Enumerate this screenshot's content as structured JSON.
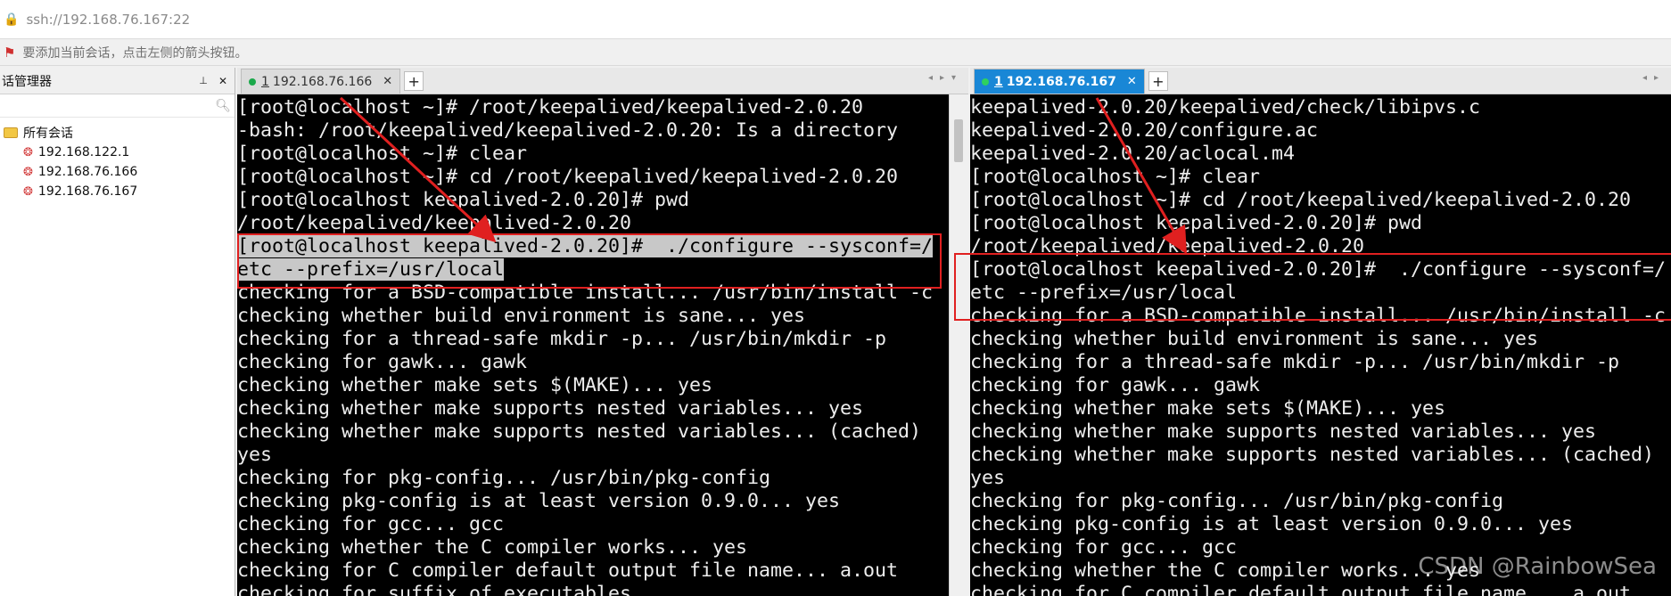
{
  "address_bar": {
    "url": "ssh://192.168.76.167:22"
  },
  "hint_bar": {
    "text": "要添加当前会话，点击左侧的箭头按钮。"
  },
  "session_manager": {
    "title": "话管理器",
    "pin": "📌",
    "close": "✕",
    "tree": {
      "root": "所有会话",
      "children": [
        "192.168.122.1",
        "192.168.76.166",
        "192.168.76.167"
      ]
    }
  },
  "left_pane": {
    "tab": {
      "num": "1",
      "label": "192.168.76.166",
      "close": "✕"
    },
    "lines": [
      "[root@localhost ~]# /root/keepalived/keepalived-2.0.20",
      "-bash: /root/keepalived/keepalived-2.0.20: Is a directory",
      "[root@localhost ~]# clear",
      "[root@localhost ~]# cd /root/keepalived/keepalived-2.0.20",
      "[root@localhost keepalived-2.0.20]# pwd",
      "/root/keepalived/keepalived-2.0.20",
      "[root@localhost keepalived-2.0.20]#  ./configure --sysconf=/",
      "etc --prefix=/usr/local",
      "checking for a BSD-compatible install... /usr/bin/install -c",
      "checking whether build environment is sane... yes",
      "checking for a thread-safe mkdir -p... /usr/bin/mkdir -p",
      "checking for gawk... gawk",
      "checking whether make sets $(MAKE)... yes",
      "checking whether make supports nested variables... yes",
      "checking whether make supports nested variables... (cached)",
      "yes",
      "checking for pkg-config... /usr/bin/pkg-config",
      "checking pkg-config is at least version 0.9.0... yes",
      "checking for gcc... gcc",
      "checking whether the C compiler works... yes",
      "checking for C compiler default output file name... a.out",
      "checking for suffix of executables..."
    ]
  },
  "right_pane": {
    "tab": {
      "num": "1",
      "label": "192.168.76.167",
      "close": "✕"
    },
    "lines": [
      "keepalived-2.0.20/keepalived/check/libipvs.c",
      "keepalived-2.0.20/configure.ac",
      "keepalived-2.0.20/aclocal.m4",
      "[root@localhost ~]# clear",
      "[root@localhost ~]# cd /root/keepalived/keepalived-2.0.20",
      "[root@localhost keepalived-2.0.20]# pwd",
      "/root/keepalived/keepalived-2.0.20",
      "[root@localhost keepalived-2.0.20]#  ./configure --sysconf=/",
      "etc --prefix=/usr/local",
      "checking for a BSD-compatible install... /usr/bin/install -c",
      "checking whether build environment is sane... yes",
      "checking for a thread-safe mkdir -p... /usr/bin/mkdir -p",
      "checking for gawk... gawk",
      "checking whether make sets $(MAKE)... yes",
      "checking whether make supports nested variables... yes",
      "checking whether make supports nested variables... (cached)",
      "yes",
      "checking for pkg-config... /usr/bin/pkg-config",
      "checking pkg-config is at least version 0.9.0... yes",
      "checking for gcc... gcc",
      "checking whether the C compiler works... yes",
      "checking for C compiler default output file name... a.out"
    ]
  },
  "watermark": "CSDN @RainbowSea",
  "colors": {
    "accent": "#1987d6",
    "annotation": "#e02020",
    "terminal_bg": "#000000"
  },
  "icons": [
    "lock-icon",
    "flag-icon",
    "pin-icon",
    "close-icon",
    "search-icon",
    "folder-icon",
    "session-icon",
    "plus-icon"
  ]
}
